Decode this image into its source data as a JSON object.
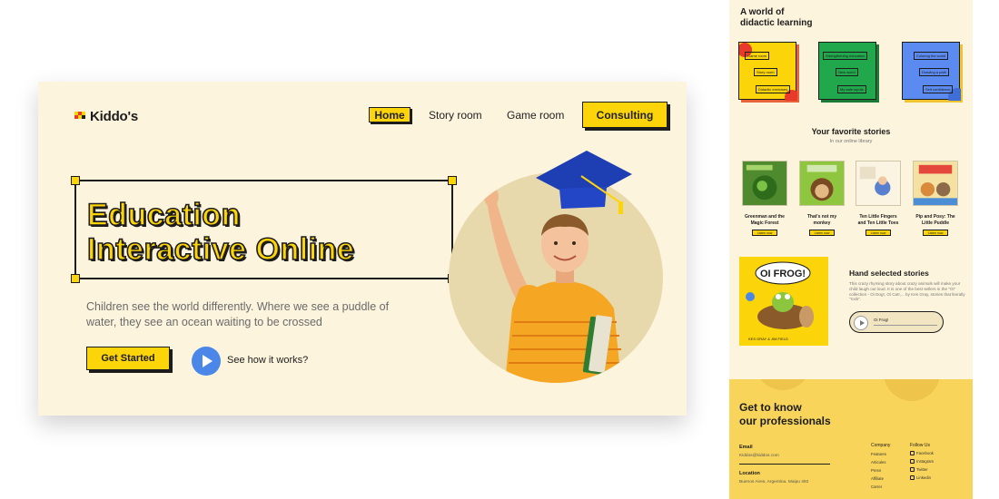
{
  "hero": {
    "logo": "Kiddo's",
    "nav": {
      "home": "Home",
      "story": "Story room",
      "game": "Game room",
      "consulting": "Consulting"
    },
    "headline_line1": "Education",
    "headline_line2": "Interactive Online",
    "subtitle": "Children see the world differently. Where we see a puddle of water, they see an ocean waiting to be crossed",
    "cta": "Get Started",
    "how": "See how it works?"
  },
  "page": {
    "world_title_1": "A world of",
    "world_title_2": "didactic learning",
    "tiles": [
      {
        "labels": [
          "Game room",
          "Story room",
          "Didactic exercises"
        ],
        "color": "#fcd40a",
        "back": "#e85c2a"
      },
      {
        "labels": [
          "Strengthening education",
          "New world",
          "My safe inputs"
        ],
        "color": "#1fa34a",
        "back": "#1c7a36"
      },
      {
        "labels": [
          "Coloring the world",
          "Drawing a path",
          "Self confidence"
        ],
        "color": "#5b8bf0",
        "back": "#f0c330"
      }
    ],
    "fav_title": "Your favorite stories",
    "fav_sub": "In our online library",
    "books": [
      {
        "title": "Greenman and the Magic Forest",
        "button": "Listen now"
      },
      {
        "title": "That's not my monkey",
        "button": "Listen now"
      },
      {
        "title": "Ten Little Fingers and Ten Little Toes",
        "button": "Listen now"
      },
      {
        "title": "Pip and Posy: The Little Puddle",
        "button": "Listen now"
      }
    ],
    "oifrog_cover": "OI FROG!",
    "oifrog_authors": "KES GRAY & JIM FIELD",
    "hs_title": "Hand selected stories",
    "hs_desc": "This crazy rhyming story about crazy animals will make your child laugh out loud. It is one of the best sellers in the \"Oi\" collection - Oi Dog!, Oi Cat!,... by Kes Gray, stories that literally \"rock\".",
    "player_track": "Oi Frog!",
    "footer": {
      "title_1": "Get to know",
      "title_2": "our professionals",
      "email_label": "Email",
      "email_value": "Kiddos@kiddos.com",
      "location_label": "Location",
      "location_value": "Buenos Aires, Argentina. Maipu 492",
      "company_head": "Company",
      "company_items": [
        "Features",
        "Articules",
        "Press",
        "Affiliate",
        "Carrer"
      ],
      "follow_head": "Follow Us",
      "follow_items": [
        "Facebook",
        "Instagram",
        "Twitter",
        "Linkedin"
      ]
    }
  }
}
